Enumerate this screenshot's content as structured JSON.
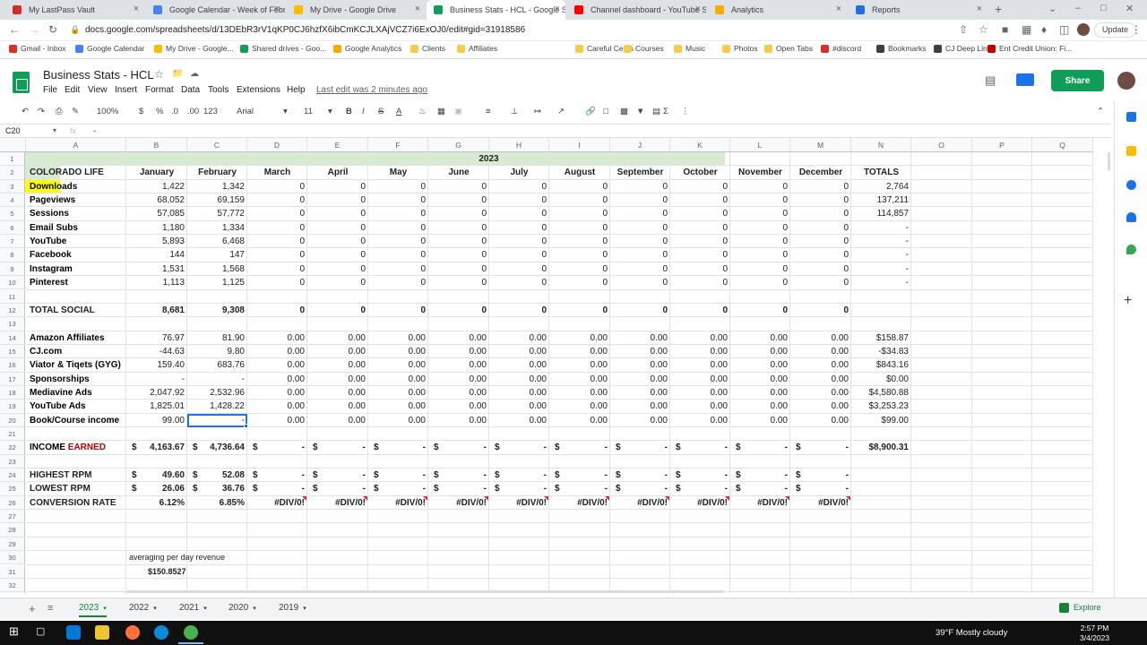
{
  "browser": {
    "tabs": [
      {
        "title": "My LastPass Vault",
        "color": "#d32d27"
      },
      {
        "title": "Google Calendar - Week of Febr",
        "color": "#4285f4"
      },
      {
        "title": "My Drive - Google Drive",
        "color": "#fbbc04"
      },
      {
        "title": "Business Stats - HCL - Google S",
        "color": "#0f9d58"
      },
      {
        "title": "Channel dashboard - YouTube S",
        "color": "#ff0000"
      },
      {
        "title": "Analytics",
        "color": "#f9ab00"
      },
      {
        "title": "Reports",
        "color": "#1a73e8"
      }
    ],
    "url": "docs.google.com/spreadsheets/d/13DEbR3rV1qKP0CJ6hzfX6ibCmKCJLXAjVCZ7i6ExOJ0/edit#gid=31918586",
    "update_label": "Update",
    "bookmarks": [
      {
        "label": "Gmail - Inbox",
        "color": "#d93025"
      },
      {
        "label": "Google Calendar",
        "color": "#4285f4"
      },
      {
        "label": "My Drive - Google...",
        "color": "#fbbc04"
      },
      {
        "label": "Shared drives - Goo...",
        "color": "#0f9d58"
      },
      {
        "label": "Google Analytics",
        "color": "#f9ab00"
      },
      {
        "label": "Clients",
        "color": "#f7cb4d"
      },
      {
        "label": "Affiliates",
        "color": "#f7cb4d"
      },
      {
        "label": "Careful Cents",
        "color": "#f7cb4d"
      },
      {
        "label": "Courses",
        "color": "#f7cb4d"
      },
      {
        "label": "Music",
        "color": "#f7cb4d"
      },
      {
        "label": "Photos",
        "color": "#f7cb4d"
      },
      {
        "label": "Open Tabs",
        "color": "#f7cb4d"
      },
      {
        "label": "#discord",
        "color": "#d93025"
      },
      {
        "label": "Bookmarks",
        "color": "#3c4043"
      },
      {
        "label": "CJ Deep Link",
        "color": "#3c4043"
      },
      {
        "label": "Ent Credit Union: Fi...",
        "color": "#c00000"
      }
    ]
  },
  "doc": {
    "title": "Business Stats - HCL",
    "menus": [
      "File",
      "Edit",
      "View",
      "Insert",
      "Format",
      "Data",
      "Tools",
      "Extensions",
      "Help"
    ],
    "last_edit": "Last edit was 2 minutes ago",
    "share_label": "Share"
  },
  "toolbar": {
    "zoom": "100%",
    "currency": "$",
    "percent": "%",
    "dec_less": ".0",
    "dec_more": ".00",
    "format_more": "123",
    "font": "Arial",
    "size": "11"
  },
  "formula_bar": {
    "cell": "C20",
    "fx": "fx",
    "content": "-"
  },
  "sheet": {
    "columns": [
      "A",
      "B",
      "C",
      "D",
      "E",
      "F",
      "G",
      "H",
      "I",
      "J",
      "K",
      "L",
      "M",
      "N",
      "O",
      "P",
      "Q"
    ],
    "row_numbers": [
      "1",
      "2",
      "3",
      "4",
      "5",
      "6",
      "7",
      "8",
      "9",
      "10",
      "11",
      "12",
      "13",
      "14",
      "15",
      "16",
      "17",
      "18",
      "19",
      "20",
      "21",
      "22",
      "23",
      "24",
      "25",
      "26",
      "27",
      "28",
      "29",
      "30",
      "31",
      "32",
      "33"
    ],
    "year_header": "2023",
    "row2": [
      "COLORADO LIFE",
      "January",
      "February",
      "March",
      "April",
      "May",
      "June",
      "July",
      "August",
      "September",
      "October",
      "November",
      "December",
      "TOTALS"
    ],
    "traffic_rows": [
      [
        "Downloads",
        "1,422",
        "1,342",
        "0",
        "0",
        "0",
        "0",
        "0",
        "0",
        "0",
        "0",
        "0",
        "0",
        "2,764"
      ],
      [
        "Pageviews",
        "68,052",
        "69,159",
        "0",
        "0",
        "0",
        "0",
        "0",
        "0",
        "0",
        "0",
        "0",
        "0",
        "137,211"
      ],
      [
        "Sessions",
        "57,085",
        "57,772",
        "0",
        "0",
        "0",
        "0",
        "0",
        "0",
        "0",
        "0",
        "0",
        "0",
        "114,857"
      ],
      [
        "Email Subs",
        "1,180",
        "1,334",
        "0",
        "0",
        "0",
        "0",
        "0",
        "0",
        "0",
        "0",
        "0",
        "0",
        "-"
      ],
      [
        "YouTube",
        "5,893",
        "6,468",
        "0",
        "0",
        "0",
        "0",
        "0",
        "0",
        "0",
        "0",
        "0",
        "0",
        "-"
      ],
      [
        "Facebook",
        "144",
        "147",
        "0",
        "0",
        "0",
        "0",
        "0",
        "0",
        "0",
        "0",
        "0",
        "0",
        "-"
      ],
      [
        "Instagram",
        "1,531",
        "1,568",
        "0",
        "0",
        "0",
        "0",
        "0",
        "0",
        "0",
        "0",
        "0",
        "0",
        "-"
      ],
      [
        "Pinterest",
        "1,113",
        "1,125",
        "0",
        "0",
        "0",
        "0",
        "0",
        "0",
        "0",
        "0",
        "0",
        "0",
        "-"
      ]
    ],
    "total_social": [
      "TOTAL SOCIAL",
      "8,681",
      "9,308",
      "0",
      "0",
      "0",
      "0",
      "0",
      "0",
      "0",
      "0",
      "0",
      "0",
      ""
    ],
    "income_rows": [
      [
        "Amazon Affiliates",
        "76.97",
        "81.90",
        "0.00",
        "0.00",
        "0.00",
        "0.00",
        "0.00",
        "0.00",
        "0.00",
        "0.00",
        "0.00",
        "0.00",
        "$158.87"
      ],
      [
        "CJ.com",
        "-44.63",
        "9.80",
        "0.00",
        "0.00",
        "0.00",
        "0.00",
        "0.00",
        "0.00",
        "0.00",
        "0.00",
        "0.00",
        "0.00",
        "-$34.83"
      ],
      [
        "Viator & Tiqets (GYG)",
        "159.40",
        "683.76",
        "0.00",
        "0.00",
        "0.00",
        "0.00",
        "0.00",
        "0.00",
        "0.00",
        "0.00",
        "0.00",
        "0.00",
        "$843.16"
      ],
      [
        "Sponsorships",
        "-",
        "-",
        "0.00",
        "0.00",
        "0.00",
        "0.00",
        "0.00",
        "0.00",
        "0.00",
        "0.00",
        "0.00",
        "0.00",
        "$0.00"
      ],
      [
        "Mediavine Ads",
        "2,047.92",
        "2,532.96",
        "0.00",
        "0.00",
        "0.00",
        "0.00",
        "0.00",
        "0.00",
        "0.00",
        "0.00",
        "0.00",
        "0.00",
        "$4,580.88"
      ],
      [
        "YouTube Ads",
        "1,825.01",
        "1,428.22",
        "0.00",
        "0.00",
        "0.00",
        "0.00",
        "0.00",
        "0.00",
        "0.00",
        "0.00",
        "0.00",
        "0.00",
        "$3,253.23"
      ],
      [
        "Book/Course income",
        "99.00",
        "-",
        "0.00",
        "0.00",
        "0.00",
        "0.00",
        "0.00",
        "0.00",
        "0.00",
        "0.00",
        "0.00",
        "0.00",
        "$99.00"
      ]
    ],
    "income_earned": {
      "label_a": "INCOME",
      "label_b": "EARNED",
      "values": [
        "4,163.67",
        "4,736.64",
        "-",
        "-",
        "-",
        "-",
        "-",
        "-",
        "-",
        "-",
        "-",
        "-"
      ],
      "total": "$8,900.31"
    },
    "highest_rpm": [
      "HIGHEST RPM",
      "49.60",
      "52.08",
      "-",
      "-",
      "-",
      "-",
      "-",
      "-",
      "-",
      "-",
      "-",
      "-"
    ],
    "lowest_rpm": [
      "LOWEST RPM",
      "26.06",
      "36.76",
      "-",
      "-",
      "-",
      "-",
      "-",
      "-",
      "-",
      "-",
      "-",
      "-"
    ],
    "conversion": [
      "CONVERSION RATE",
      "6.12%",
      "6.85%",
      "#DIV/0!",
      "#DIV/0!",
      "#DIV/0!",
      "#DIV/0!",
      "#DIV/0!",
      "#DIV/0!",
      "#DIV/0!",
      "#DIV/0!",
      "#DIV/0!",
      "#DIV/0!"
    ],
    "dollar": "$",
    "note_label": "averaging per day revenue",
    "note_value": "$150.8527"
  },
  "sheet_tabs": [
    "2023",
    "2022",
    "2021",
    "2020",
    "2019"
  ],
  "explore_label": "Explore",
  "taskbar": {
    "weather": "39°F  Mostly cloudy",
    "time": "2:57 PM",
    "date": "3/4/2023"
  }
}
